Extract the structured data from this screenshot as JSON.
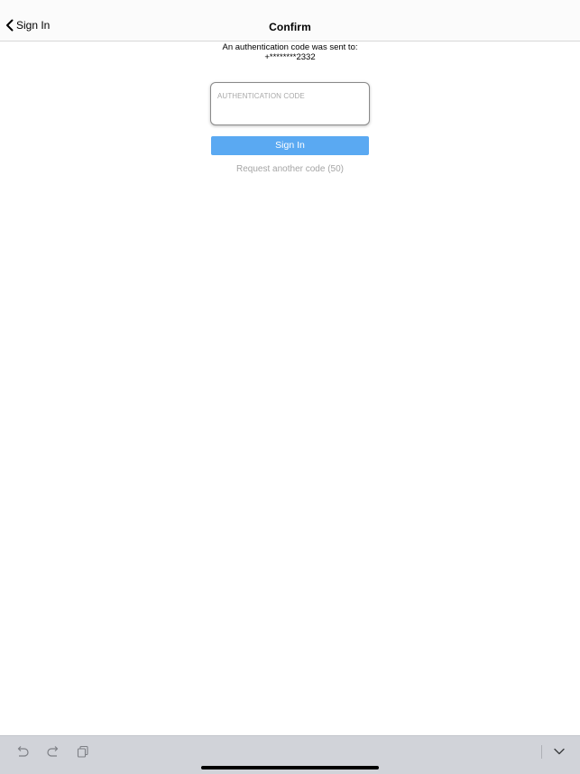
{
  "nav": {
    "back_label": "Sign In",
    "title": "Confirm"
  },
  "auth": {
    "sent_message": "An authentication code was sent to:",
    "phone_masked": "+********2332",
    "code_placeholder": "AUTHENTICATION CODE",
    "code_value": "",
    "signin_label": "Sign In",
    "request_code_label": "Request another code (50)"
  },
  "keyboard_bar": {
    "icons": [
      "undo-icon",
      "redo-icon",
      "paste-icon",
      "dismiss-keyboard-icon"
    ]
  },
  "colors": {
    "accent_button": "#5aa9f2",
    "disabled_text": "#a5a5a5",
    "toolbar_bg": "#d1d3d9"
  }
}
